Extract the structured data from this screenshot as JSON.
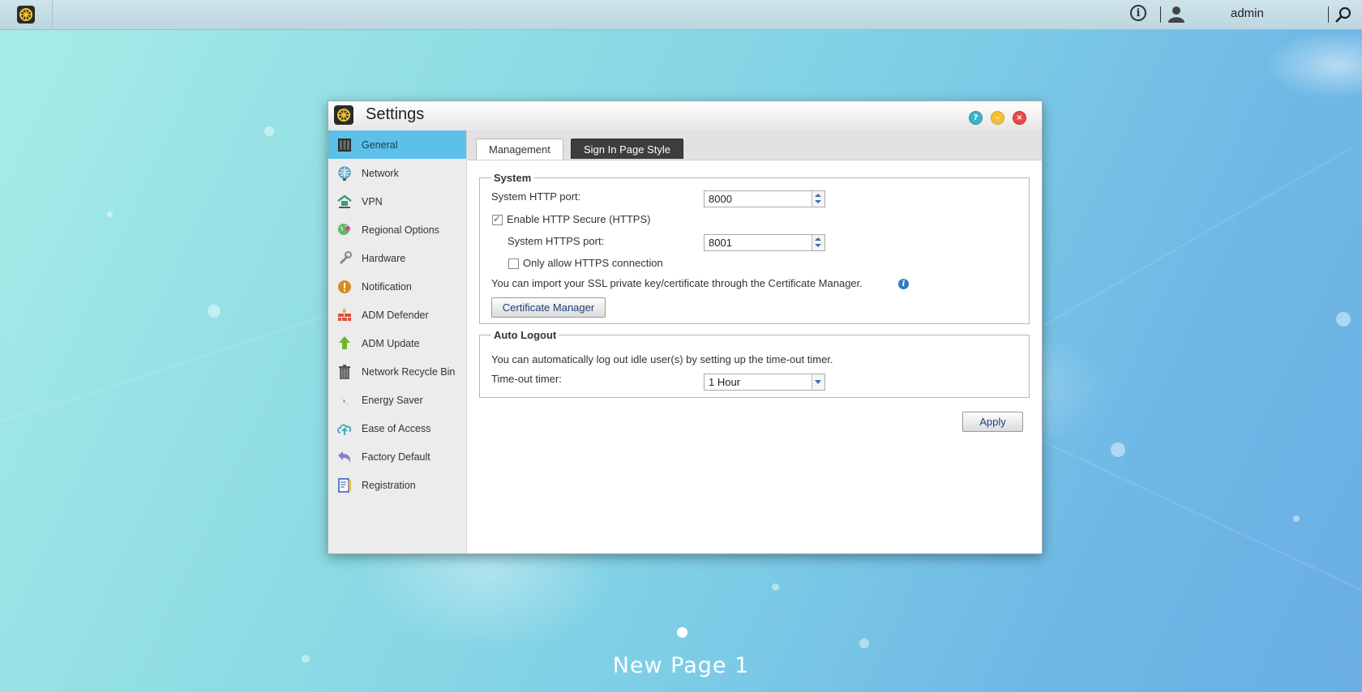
{
  "topbar": {
    "username": "admin",
    "info_glyph": "i",
    "icons": [
      "app-settings-icon",
      "info-icon",
      "user-icon",
      "search-icon"
    ]
  },
  "window": {
    "title": "Settings",
    "controls": {
      "help": "?",
      "minimize": "–",
      "close": "×"
    }
  },
  "sidebar": {
    "items": [
      {
        "label": "General",
        "icon": "general-icon",
        "active": true
      },
      {
        "label": "Network",
        "icon": "network-globe-icon"
      },
      {
        "label": "VPN",
        "icon": "vpn-icon"
      },
      {
        "label": "Regional Options",
        "icon": "regional-options-icon"
      },
      {
        "label": "Hardware",
        "icon": "hardware-icon"
      },
      {
        "label": "Notification",
        "icon": "notification-icon"
      },
      {
        "label": "ADM Defender",
        "icon": "firewall-icon"
      },
      {
        "label": "ADM Update",
        "icon": "update-arrow-icon"
      },
      {
        "label": "Network Recycle Bin",
        "icon": "recycle-bin-icon"
      },
      {
        "label": "Energy Saver",
        "icon": "energy-bolt-icon"
      },
      {
        "label": "Ease of Access",
        "icon": "cloud-upload-icon"
      },
      {
        "label": "Factory Default",
        "icon": "undo-arrow-icon"
      },
      {
        "label": "Registration",
        "icon": "registration-clipboard-icon"
      }
    ]
  },
  "tabs": {
    "management": "Management",
    "sign_in_page_style": "Sign In Page Style"
  },
  "system": {
    "legend": "System",
    "http_port_label": "System HTTP port:",
    "http_port_value": "8000",
    "enable_https_label": "Enable HTTP Secure (HTTPS)",
    "enable_https_checked": true,
    "https_port_label": "System HTTPS port:",
    "https_port_value": "8001",
    "only_https_label": "Only allow HTTPS connection",
    "only_https_checked": false,
    "ssl_note": "You can import your SSL private key/certificate through the Certificate Manager.",
    "info_glyph": "i",
    "cert_manager_button": "Certificate Manager"
  },
  "auto_logout": {
    "legend": "Auto Logout",
    "note": "You can automatically log out idle user(s) by setting up the time-out timer.",
    "timer_label": "Time-out timer:",
    "timer_value": "1 Hour"
  },
  "apply_button": "Apply",
  "desktop": {
    "page_label": "New Page 1"
  },
  "colors": {
    "sidebar_active": "#5cc0e8",
    "tab_dark": "#3d3d3d",
    "help_button": "#3fb3c9",
    "minimize_button": "#f2c234",
    "close_button": "#e84b4b"
  }
}
